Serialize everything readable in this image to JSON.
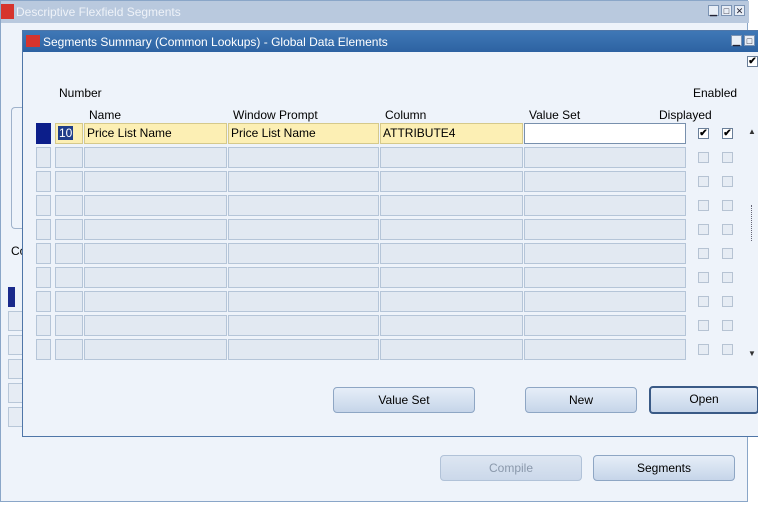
{
  "outer_window": {
    "title": "Descriptive Flexfield Segments",
    "bg_label": "Co",
    "buttons": {
      "compile": "Compile",
      "segments": "Segments"
    }
  },
  "window_controls": {
    "minimize": "▁",
    "maximize": "□",
    "close": "✕"
  },
  "dialog": {
    "title": "Segments Summary (Common Lookups) - Global Data Elements",
    "headers": {
      "number": "Number",
      "name": "Name",
      "window_prompt": "Window Prompt",
      "column": "Column",
      "value_set": "Value Set",
      "displayed": "Displayed",
      "enabled": "Enabled"
    },
    "rows": [
      {
        "number": "10",
        "name": "Price List Name",
        "window_prompt": "Price List Name",
        "column": "ATTRIBUTE4",
        "value_set": "",
        "displayed": true,
        "enabled": true
      },
      {
        "number": "",
        "name": "",
        "window_prompt": "",
        "column": "",
        "value_set": "",
        "displayed": false,
        "enabled": false
      },
      {
        "number": "",
        "name": "",
        "window_prompt": "",
        "column": "",
        "value_set": "",
        "displayed": false,
        "enabled": false
      },
      {
        "number": "",
        "name": "",
        "window_prompt": "",
        "column": "",
        "value_set": "",
        "displayed": false,
        "enabled": false
      },
      {
        "number": "",
        "name": "",
        "window_prompt": "",
        "column": "",
        "value_set": "",
        "displayed": false,
        "enabled": false
      },
      {
        "number": "",
        "name": "",
        "window_prompt": "",
        "column": "",
        "value_set": "",
        "displayed": false,
        "enabled": false
      },
      {
        "number": "",
        "name": "",
        "window_prompt": "",
        "column": "",
        "value_set": "",
        "displayed": false,
        "enabled": false
      },
      {
        "number": "",
        "name": "",
        "window_prompt": "",
        "column": "",
        "value_set": "",
        "displayed": false,
        "enabled": false
      },
      {
        "number": "",
        "name": "",
        "window_prompt": "",
        "column": "",
        "value_set": "",
        "displayed": false,
        "enabled": false
      },
      {
        "number": "",
        "name": "",
        "window_prompt": "",
        "column": "",
        "value_set": "",
        "displayed": false,
        "enabled": false
      }
    ],
    "buttons": {
      "value_set": "Value Set",
      "new": "New",
      "open": "Open"
    },
    "check_mark": "✔"
  },
  "colors": {
    "title_bar": "#2d62a2",
    "selected_row": "#0c1e8a",
    "current_field": "#fcefb4",
    "canvas": "#eef3fa"
  },
  "icons": {
    "app_logo": "oracle-logo-icon",
    "scroll_up": "scroll-up-icon",
    "scroll_down": "scroll-down-icon"
  }
}
